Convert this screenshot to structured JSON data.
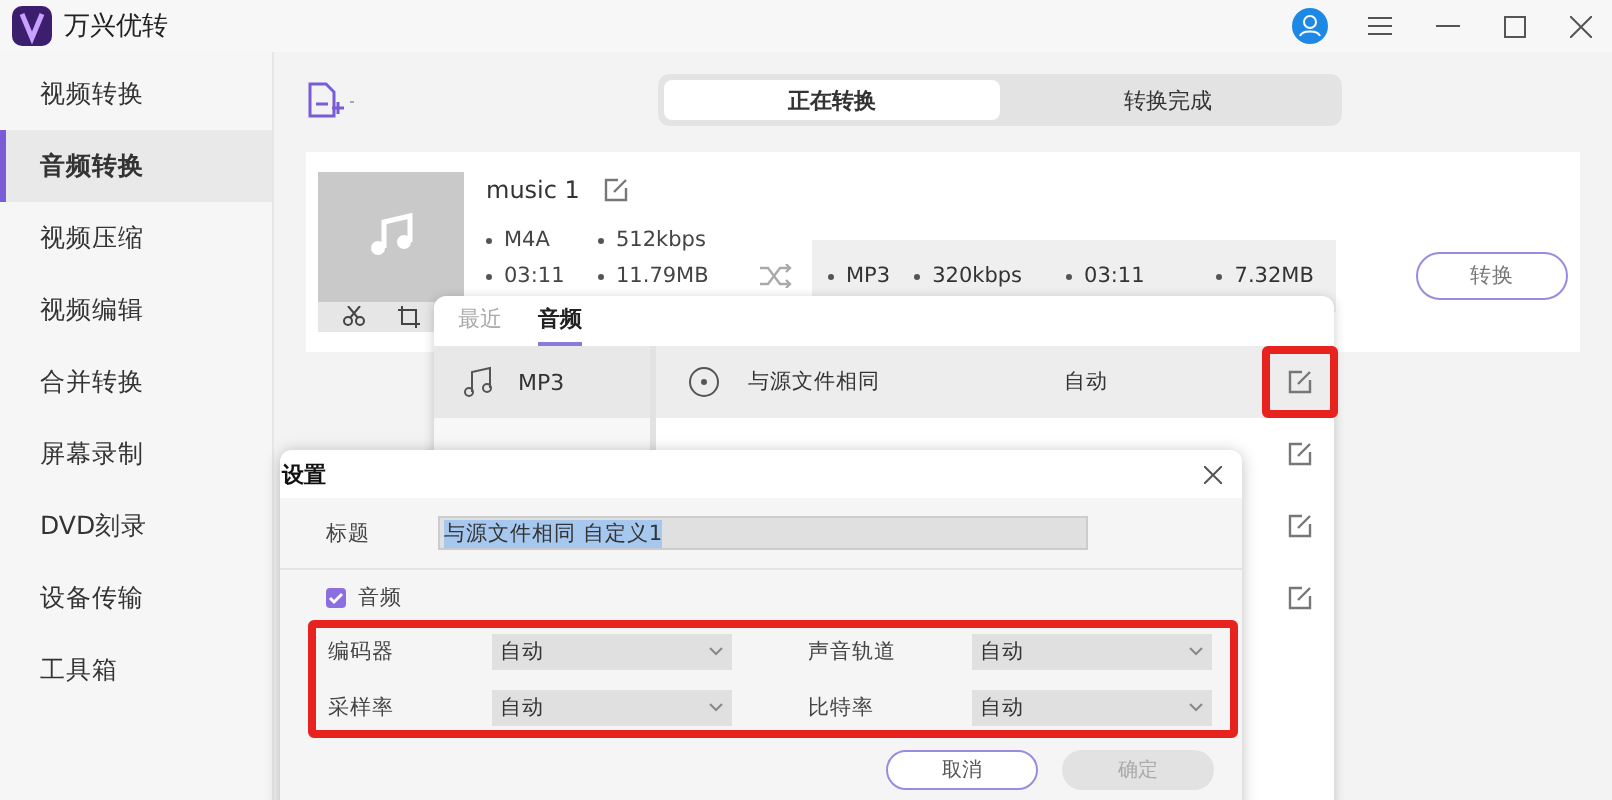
{
  "app": {
    "title": "万兴优转"
  },
  "sidebar": {
    "items": [
      {
        "label": "视频转换",
        "selected": false
      },
      {
        "label": "音频转换",
        "selected": true
      },
      {
        "label": "视频压缩",
        "selected": false
      },
      {
        "label": "视频编辑",
        "selected": false
      },
      {
        "label": "合并转换",
        "selected": false
      },
      {
        "label": "屏幕录制",
        "selected": false
      },
      {
        "label": "DVD刻录",
        "selected": false
      },
      {
        "label": "设备传输",
        "selected": false
      },
      {
        "label": "工具箱",
        "selected": false
      }
    ]
  },
  "tabs": [
    {
      "label": "正在转换",
      "selected": true
    },
    {
      "label": "转换完成",
      "selected": false
    }
  ],
  "file": {
    "name": "music 1",
    "source": [
      "M4A",
      "512kbps",
      "03:11",
      "11.79MB"
    ],
    "target": [
      "MP3",
      "320kbps",
      "03:11",
      "7.32MB"
    ],
    "convert_button": "转换"
  },
  "format_popup": {
    "tabs": [
      {
        "label": "最近",
        "selected": false
      },
      {
        "label": "音频",
        "selected": true
      }
    ],
    "formats": [
      {
        "label": "MP3",
        "selected": true
      }
    ],
    "presets": [
      {
        "kind": "visible",
        "name": "与源文件相同",
        "value": "自动",
        "selected": true,
        "highlighted": true
      },
      {
        "kind": "covered",
        "selected": false,
        "highlighted": false
      },
      {
        "kind": "covered",
        "selected": false,
        "highlighted": false
      },
      {
        "kind": "covered",
        "selected": false,
        "highlighted": false
      }
    ]
  },
  "dialog": {
    "title": "设置",
    "title_label": "标题",
    "title_value": "与源文件相同 自定义1",
    "title_value_selected": true,
    "audio": {
      "label": "音频",
      "checked": true
    },
    "fields_highlighted": true,
    "fields": [
      {
        "label": "编码器",
        "value": "自动"
      },
      {
        "label": "声音轨道",
        "value": "自动"
      },
      {
        "label": "采样率",
        "value": "自动"
      },
      {
        "label": "比特率",
        "value": "自动"
      }
    ],
    "buttons": [
      {
        "label": "取消",
        "kind": "secondary",
        "disabled": false
      },
      {
        "label": "确定",
        "kind": "primary",
        "disabled": true
      }
    ]
  }
}
